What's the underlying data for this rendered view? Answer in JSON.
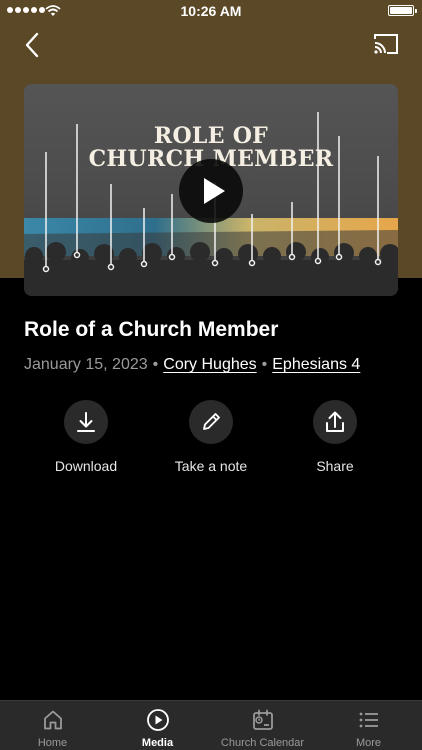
{
  "status_bar": {
    "time": "10:26 AM"
  },
  "header": {
    "back_icon": "chevron-left-icon",
    "cast_icon": "cast-icon",
    "background_color": "#5b4827"
  },
  "media": {
    "thumbnail_title_line1": "ROLE OF",
    "thumbnail_title_line2": "CHURCH MEMBER",
    "play_icon": "play-icon",
    "title": "Role of a Church Member",
    "date": "January 15, 2023",
    "speaker": "Cory Hughes",
    "passage": "Ephesians 4",
    "separator": "•"
  },
  "actions": [
    {
      "label": "Download",
      "icon": "download-icon"
    },
    {
      "label": "Take a note",
      "icon": "pencil-icon"
    },
    {
      "label": "Share",
      "icon": "share-icon"
    }
  ],
  "tab_bar": {
    "active": "Media",
    "tabs": [
      {
        "label": "Home",
        "icon": "home-icon"
      },
      {
        "label": "Media",
        "icon": "play-circle-icon"
      },
      {
        "label": "Church Calendar",
        "icon": "calendar-icon"
      },
      {
        "label": "More",
        "icon": "list-icon"
      }
    ]
  }
}
